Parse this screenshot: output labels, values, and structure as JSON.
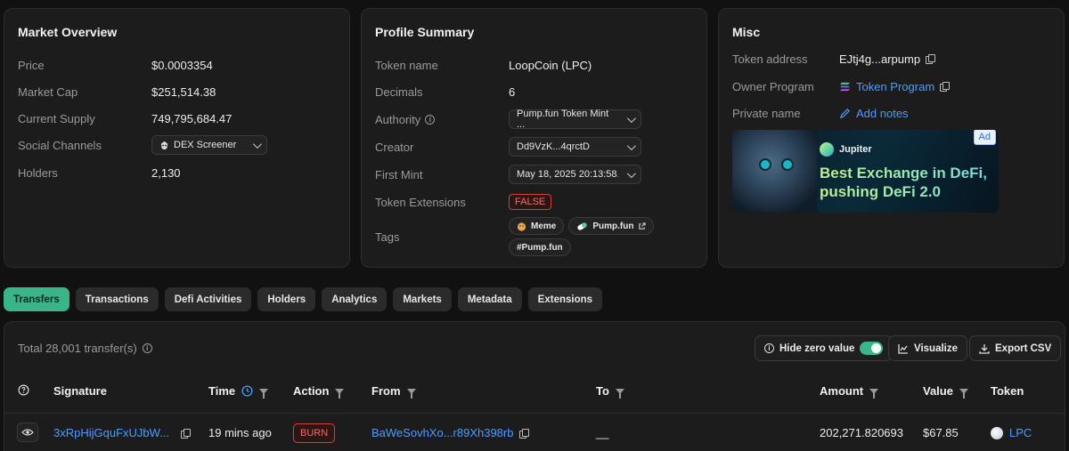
{
  "market": {
    "title": "Market Overview",
    "rows": [
      {
        "label": "Price",
        "value": "$0.0003354"
      },
      {
        "label": "Market Cap",
        "value": "$251,514.38"
      },
      {
        "label": "Current Supply",
        "value": "749,795,684.47"
      },
      {
        "label": "Social Channels",
        "value": "DEX Screener"
      },
      {
        "label": "Holders",
        "value": "2,130"
      }
    ]
  },
  "profile": {
    "title": "Profile Summary",
    "token_name_label": "Token name",
    "token_name": "LoopCoin (LPC)",
    "decimals_label": "Decimals",
    "decimals": "6",
    "authority_label": "Authority",
    "authority": "Pump.fun Token Mint ...",
    "creator_label": "Creator",
    "creator": "Dd9VzK...4qrctD",
    "first_mint_label": "First Mint",
    "first_mint": "May 18, 2025 20:13:58...",
    "extensions_label": "Token Extensions",
    "extensions": "FALSE",
    "tags_label": "Tags",
    "tags": [
      "Meme",
      "Pump.fun",
      "#Pump.fun"
    ]
  },
  "misc": {
    "title": "Misc",
    "address_label": "Token address",
    "address": "EJtj4g...arpump",
    "owner_label": "Owner Program",
    "owner": "Token Program",
    "private_label": "Private name",
    "private": "Add notes",
    "ad_label": "Ad",
    "ad_brand": "Jupiter",
    "ad_line1": "Best Exchange in DeFi,",
    "ad_line2": "pushing DeFi 2.0"
  },
  "tabs": [
    "Transfers",
    "Transactions",
    "Defi Activities",
    "Holders",
    "Analytics",
    "Markets",
    "Metadata",
    "Extensions"
  ],
  "transfers": {
    "total": "Total 28,001 transfer(s)",
    "hide_zero": "Hide zero value",
    "visualize": "Visualize",
    "export": "Export CSV",
    "columns": {
      "signature": "Signature",
      "time": "Time",
      "action": "Action",
      "from": "From",
      "to": "To",
      "amount": "Amount",
      "value": "Value",
      "token": "Token"
    },
    "row": {
      "signature": "3xRpHijGquFxUJbW...",
      "time": "19 mins ago",
      "action": "BURN",
      "from": "BaWeSovhXo...r89Xh398rb",
      "to": "__",
      "amount": "202,271.820693",
      "value": "$67.85",
      "token": "LPC"
    }
  },
  "colors": {
    "accent": "#3ab58a",
    "link": "#4a9dff",
    "danger": "#ff6b61"
  }
}
